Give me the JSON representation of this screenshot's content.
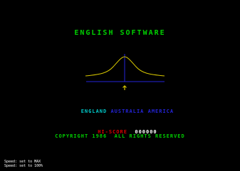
{
  "colors": {
    "background": "#000000",
    "green": "#00d000",
    "yellow": "#d8c800",
    "cyan": "#00c8c8",
    "blue": "#2424d8",
    "red": "#d80000",
    "white": "#ffffff",
    "log_white": "#ffffff"
  },
  "title": "ENGLISH SOFTWARE",
  "countries": {
    "selected": "ENGLAND",
    "other_1": "AUSTRALIA",
    "other_2": "AMERICA"
  },
  "hiscore": {
    "label": "HI-SCORE",
    "value": "000000"
  },
  "copyright": "COPYRIGHT 1986  ALL RIGHTS RESERVED",
  "speed_log": [
    "Speed: set to MAX",
    "Speed: set to 100%"
  ],
  "icons": {
    "logo": "bell-curve-logo",
    "cursor": "up-arrow-icon"
  }
}
